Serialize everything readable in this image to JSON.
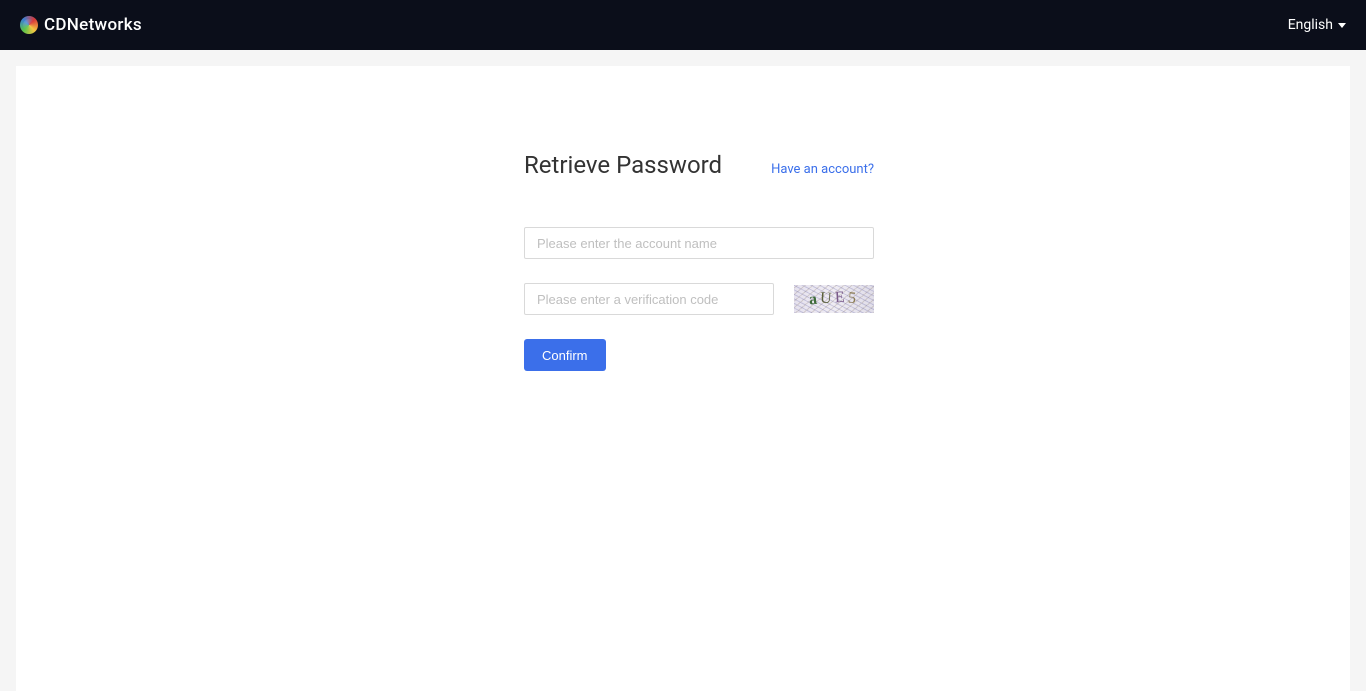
{
  "header": {
    "brand": "CDNetworks",
    "language": "English"
  },
  "form": {
    "title": "Retrieve Password",
    "have_account": "Have an account?",
    "account_placeholder": "Please enter the account name",
    "verify_placeholder": "Please enter a verification code",
    "captcha": {
      "c1": "a",
      "c2": "U",
      "c3": "E",
      "c4": "5"
    },
    "confirm": "Confirm"
  }
}
